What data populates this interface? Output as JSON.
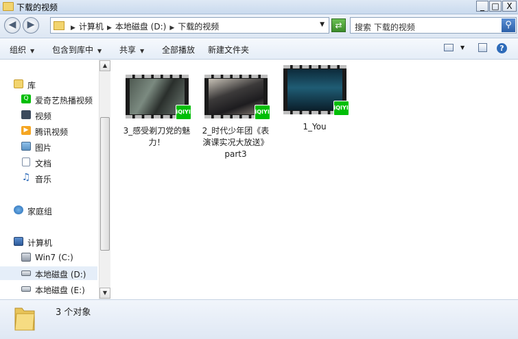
{
  "window": {
    "title": "下载的视频"
  },
  "titlebar_buttons": {
    "minimize": "_",
    "maximize": "□",
    "close": "X"
  },
  "address": {
    "crumbs": [
      "计算机",
      "本地磁盘 (D:)",
      "下载的视频"
    ]
  },
  "search": {
    "placeholder": "搜索 下载的视频"
  },
  "toolbar": {
    "organize": "组织",
    "include_library": "包含到库中",
    "share": "共享",
    "play_all": "全部播放",
    "new_folder": "新建文件夹"
  },
  "nav": {
    "library": "库",
    "iqiyi": "爱奇艺热播视频",
    "video": "视频",
    "tencent": "腾讯视频",
    "pictures": "图片",
    "documents": "文档",
    "music": "音乐",
    "homegroup": "家庭组",
    "computer": "计算机",
    "drive_c": "Win7 (C:)",
    "drive_d": "本地磁盘 (D:)",
    "drive_e": "本地磁盘 (E:)"
  },
  "files": [
    {
      "name": "3_感受剃刀党的魅力！"
    },
    {
      "name": "2_时代少年团《表演课实况大放送》part3"
    },
    {
      "name": "1_You"
    }
  ],
  "badge_text": "iQIYI",
  "status": {
    "count": "3 个对象"
  },
  "colors": {
    "iqiyi_green": "#00be06",
    "selection": "#e5eef9"
  }
}
